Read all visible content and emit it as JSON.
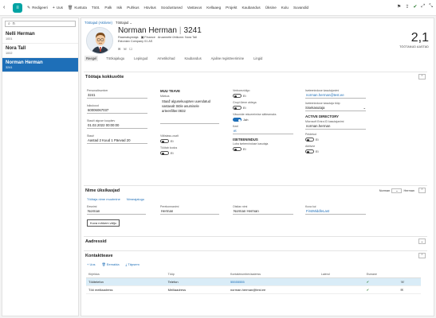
{
  "topbar": {
    "items": [
      {
        "icon": "pencil-icon",
        "glyph": "✎",
        "label": "Redigeeri"
      },
      {
        "icon": "plus-icon",
        "glyph": "+",
        "label": "Uus"
      },
      {
        "icon": "delete-icon",
        "glyph": "🗑",
        "label": "Kustuta"
      },
      {
        "icon": "",
        "glyph": "",
        "label": "Tööt."
      },
      {
        "icon": "",
        "glyph": "",
        "label": "Palk"
      },
      {
        "icon": "",
        "glyph": "",
        "label": "Isik"
      },
      {
        "icon": "",
        "glyph": "",
        "label": "Puhkus"
      },
      {
        "icon": "",
        "glyph": "",
        "label": "Hüvitus"
      },
      {
        "icon": "",
        "glyph": "",
        "label": "Soodustused"
      },
      {
        "icon": "",
        "glyph": "",
        "label": "Vastavus"
      },
      {
        "icon": "",
        "glyph": "",
        "label": "Kellaaeg"
      },
      {
        "icon": "",
        "glyph": "",
        "label": "Projekt"
      },
      {
        "icon": "",
        "glyph": "",
        "label": "Kaubandus"
      },
      {
        "icon": "",
        "glyph": "",
        "label": "Üksine"
      },
      {
        "icon": "",
        "glyph": "",
        "label": "Kulu"
      },
      {
        "icon": "",
        "glyph": "",
        "label": "Suvandid"
      }
    ],
    "right_icons": [
      "bookmark-icon",
      "share-icon",
      "edit-check-icon",
      "expand-icon",
      "collapse-icon"
    ]
  },
  "left": {
    "search_value": "n",
    "items": [
      {
        "name": "Nelli Herman",
        "no": "1001"
      },
      {
        "name": "Nora Tall",
        "no": "1002"
      },
      {
        "name": "Norman Herman",
        "no": "3241"
      }
    ]
  },
  "header": {
    "breadcrumb": [
      "Töötajad (Aktiivne)",
      "Töötajad ⌄"
    ],
    "name": "Norman Herman",
    "number": "3241",
    "title": "Raamatupidaja",
    "dept": "Finance",
    "manager": "Aruannete ühtkonn: Nora Tall",
    "company": "Estonian Company 01 AS",
    "kpi_value": "2,1",
    "kpi_label": "TÖÖTANUD AASTAD"
  },
  "tabs": [
    {
      "label": "Reegel",
      "active": true
    },
    {
      "label": "Töökajalugu",
      "active": false
    },
    {
      "label": "Lepingud",
      "active": false
    },
    {
      "label": "Ametikohad",
      "active": false
    },
    {
      "label": "Kaubandus",
      "active": false
    },
    {
      "label": "Ajaline registreerimine",
      "active": false
    },
    {
      "label": "Lingid",
      "active": false
    }
  ],
  "employee_details": {
    "title": "Töötaja kokkuvõte",
    "personnel_no_label": "Personalinumber",
    "personnel_no": "3241",
    "id_label": "Isikukood",
    "id": "60006067037",
    "start_label": "Staaži algusе kuupäev",
    "start": "01.02.2022 00:00:00",
    "seniority_label": "Staaž",
    "seniority": "Aastad 2 Kuud 1 Päevad 20",
    "more_title": "MUU TEAVE",
    "memo_label": "Märkus",
    "memo": "Staaž algusekuupäev uuendatud vastavalt tööle asumisele arteesfilter.0832",
    "travel_label": "Välistasu-osalt",
    "travel_state": "Ei",
    "worker_label": "Töötab kodus",
    "worker_state": "Ei",
    "hide_label": "Verborezidigo",
    "hide_state": "Ei",
    "group_label": "Grupi ülene aldega",
    "group_state": "Ei",
    "pay_label": "Väsunide rekueerimise sätteamaks",
    "pay_state": "Jah",
    "lang_label": "Keel",
    "lang": "et",
    "auth_title": "ISETEENINDUS",
    "auth_label": "Luba iseteeninduse kasutaja",
    "auth_state": "Ei",
    "user_label": "Iseteeninduse kasutajanimi",
    "user": "norman.herman@test.ee",
    "role_label": "Iseteeninduse kasutaja tüüp",
    "role": "Sisekasutaja",
    "ad_title": "ACTIVE DIRECTORY",
    "ad_label": "Microsoft Entra ID kasutajanimi",
    "ad": "norman.herman",
    "disabled_label": "Peidetud",
    "disabled_state": "Ei",
    "active_label": "Aktiivne",
    "active_state": "Ei"
  },
  "names": {
    "title": "Nime üksikasjad",
    "actions": [
      "Töötaja nime muutmine",
      "Nimeajalugu"
    ],
    "right_label_1": "Norman",
    "right_label_2": "Herman",
    "first_label": "Eesnimi",
    "first": "Norman",
    "last_label": "Perekonnanimi",
    "last": "Herman",
    "display_label": "Otsitav nimi",
    "display": "Norman Herman",
    "nick_label": "Kuva kui",
    "nick": "FirstMiddleLast",
    "more_button": "Kuva rohkem välju"
  },
  "address": {
    "title": "Aadressid"
  },
  "contacts": {
    "title": "Kontaktteave",
    "actions": [
      "+ Uus",
      "🗑 Eemalda",
      "⤓ Täpsem"
    ],
    "columns": [
      "Kirjeldus",
      "Tüüp",
      "Kontaktnumber/aadress",
      "Laiend",
      "Esmane",
      ""
    ],
    "rows": [
      {
        "desc": "Töötelefon",
        "type": "Telefon",
        "value": "55555555",
        "ext": "",
        "primary": "✔",
        "icon": "☏",
        "hl": true
      },
      {
        "desc": "Töö meiliaadress",
        "type": "Meiliaadress",
        "value": "norman.herman@test.ee",
        "ext": "",
        "primary": "✔",
        "icon": "✉",
        "hl": false
      }
    ]
  },
  "colors": {
    "accent": "#1e6fb8",
    "brand": "#00a3a3",
    "selected_row": "#d9ecf7"
  }
}
